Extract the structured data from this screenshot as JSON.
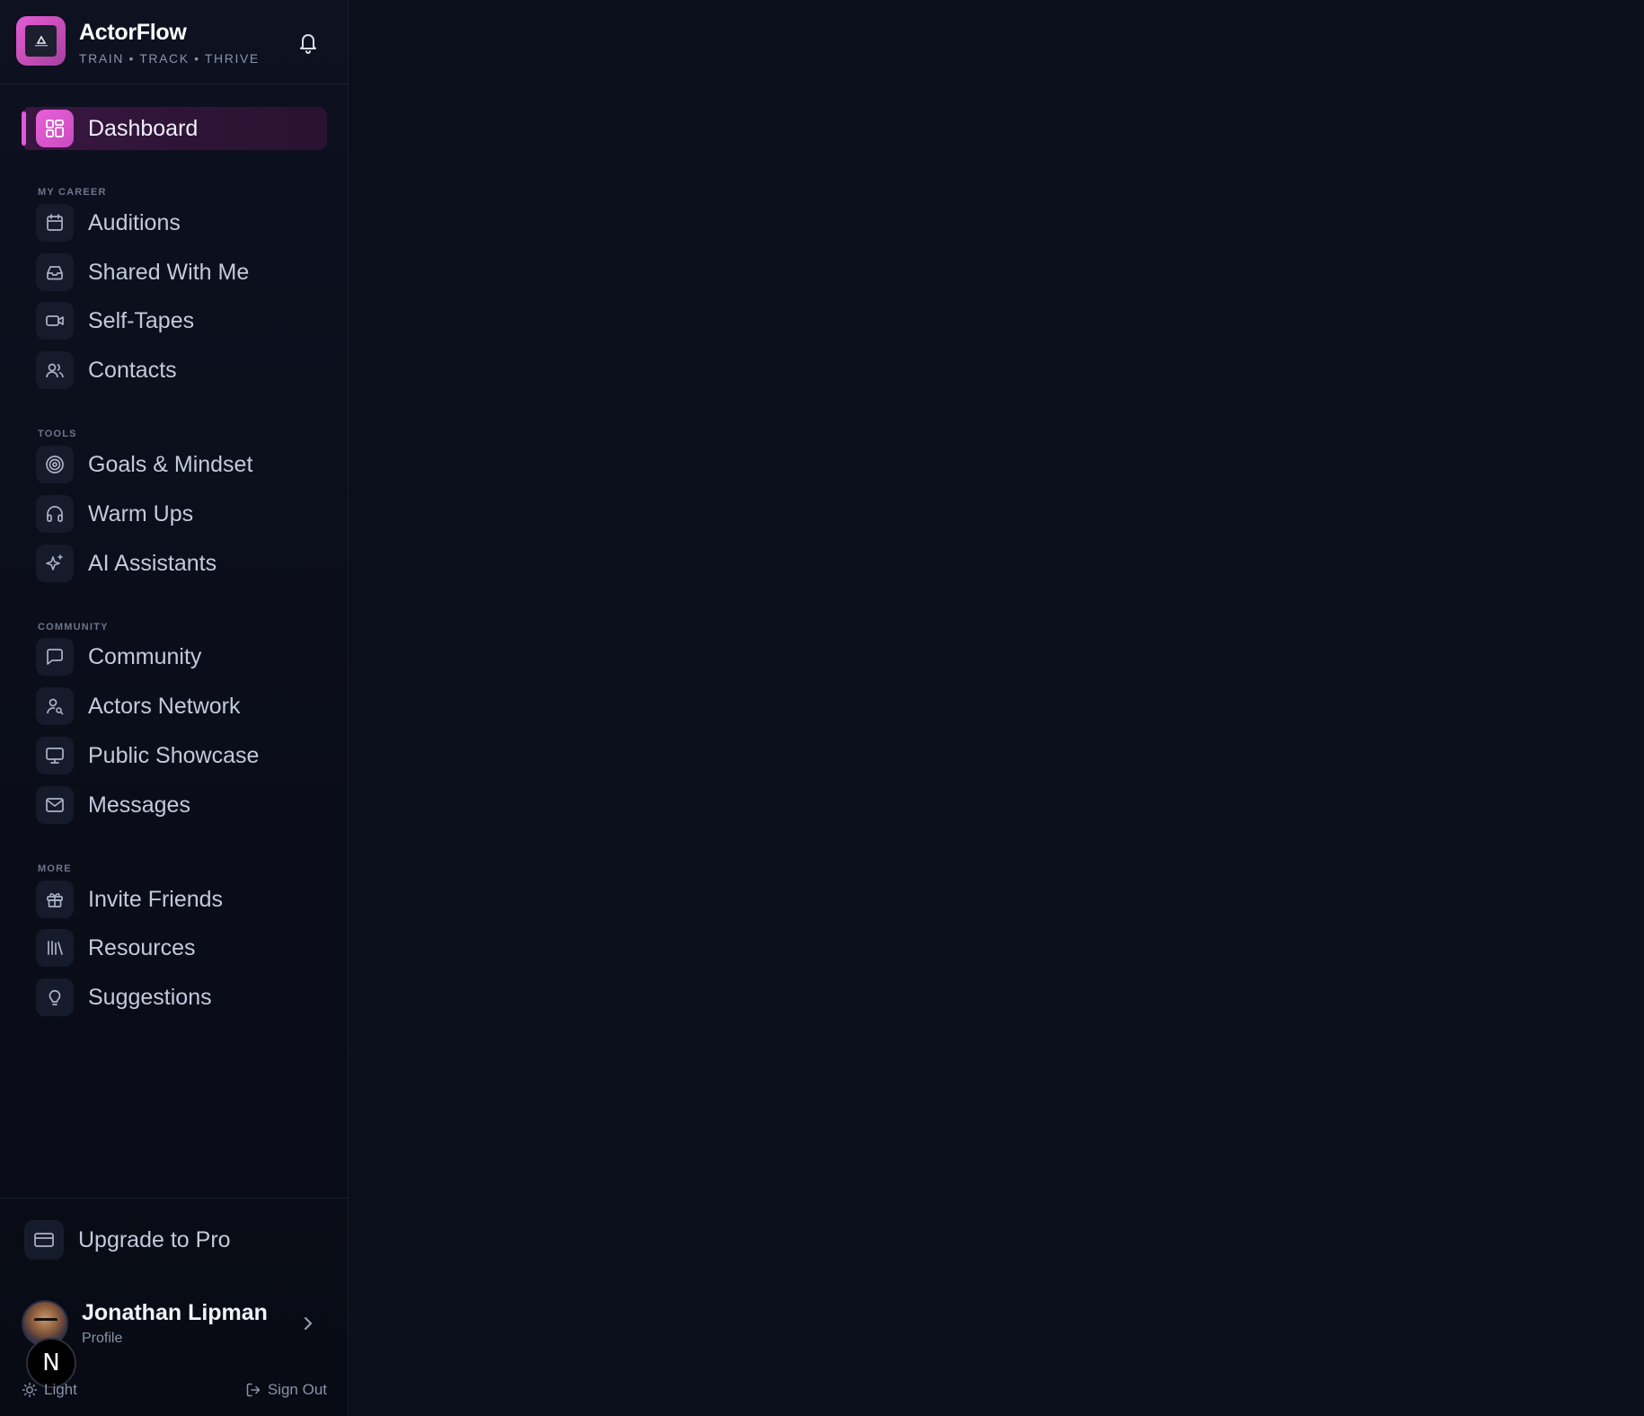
{
  "brand": {
    "name": "ActorFlow",
    "tagline": "TRAIN • TRACK • THRIVE",
    "logo_text": "ActorFlow"
  },
  "nav": {
    "dashboard": {
      "label": "Dashboard",
      "icon": "dashboard-icon"
    },
    "sections": {
      "career": "MY CAREER",
      "tools": "TOOLS",
      "community": "COMMUNITY",
      "more": "MORE"
    },
    "items": {
      "auditions": "Auditions",
      "shared": "Shared With Me",
      "selftapes": "Self-Tapes",
      "contacts": "Contacts",
      "goals": "Goals & Mindset",
      "warmups": "Warm Ups",
      "ai": "AI Assistants",
      "community": "Community",
      "network": "Actors Network",
      "showcase": "Public Showcase",
      "messages": "Messages",
      "invite": "Invite Friends",
      "resources": "Resources",
      "suggestions": "Suggestions"
    }
  },
  "upgrade": {
    "label": "Upgrade to Pro"
  },
  "profile": {
    "name": "Jonathan Lipman",
    "subtitle": "Profile"
  },
  "badge": {
    "letter": "N"
  },
  "footer": {
    "theme_label": "Light",
    "signout_label": "Sign Out"
  },
  "colors": {
    "accent": "#e05ad3",
    "background": "#0b0f1c",
    "sidebar": "#0d1120"
  }
}
